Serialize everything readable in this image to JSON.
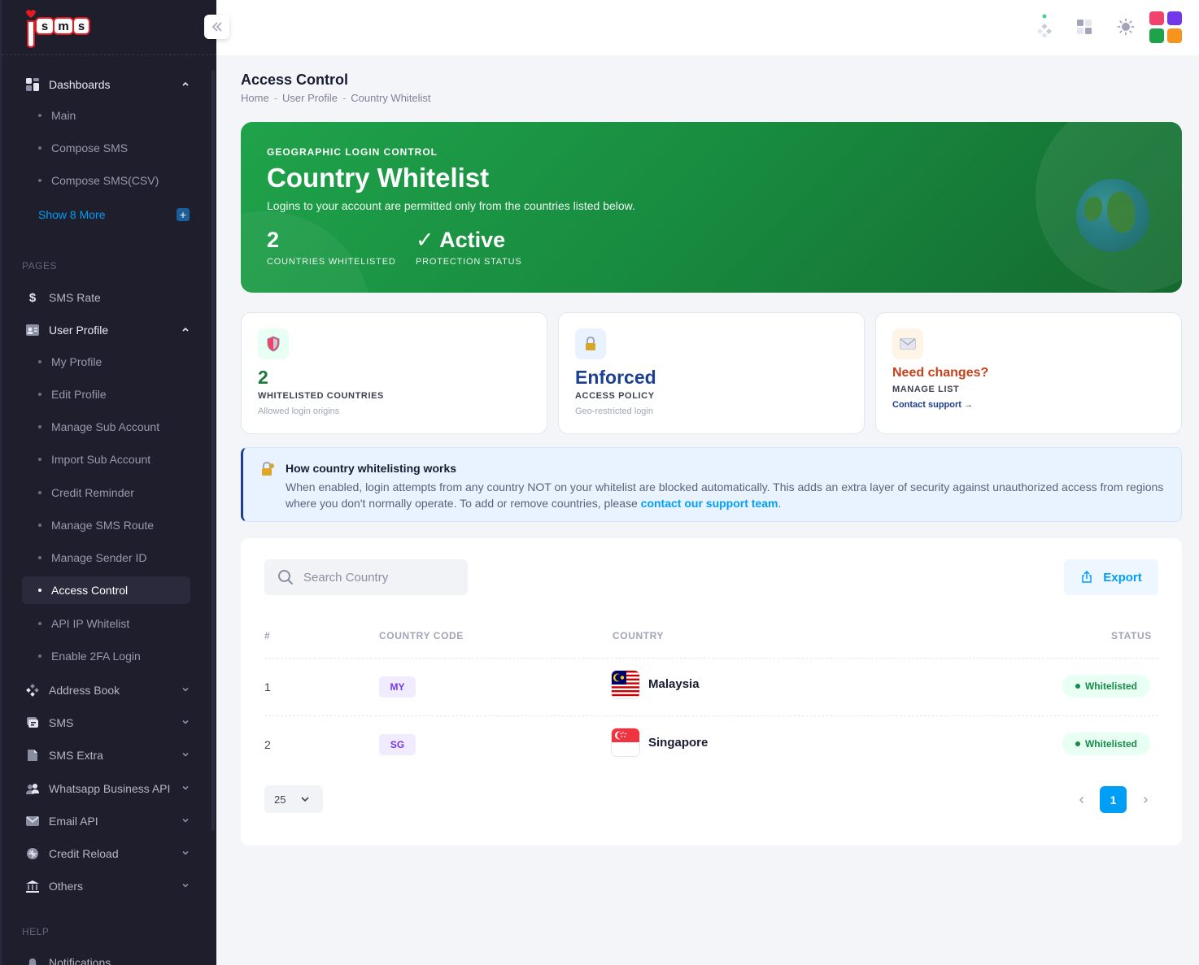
{
  "sidebar": {
    "logo_text": "sms",
    "menu": {
      "dashboards": "Dashboards",
      "dash_items": [
        "Main",
        "Compose SMS",
        "Compose SMS(CSV)"
      ],
      "show_more": "Show 8 More"
    },
    "pages_label": "PAGES",
    "sms_rate": "SMS Rate",
    "user_profile": "User Profile",
    "profile_items": [
      "My Profile",
      "Edit Profile",
      "Manage Sub Account",
      "Import Sub Account",
      "Credit Reminder",
      "Manage SMS Route",
      "Manage Sender ID",
      "Access Control",
      "API IP Whitelist",
      "Enable 2FA Login"
    ],
    "groups": [
      "Address Book",
      "SMS",
      "SMS Extra",
      "Whatsapp Business API",
      "Email API",
      "Credit Reload",
      "Others"
    ],
    "help_label": "HELP",
    "help_item": "Notifications"
  },
  "header": {
    "icons": [
      "menu-dots-icon",
      "layout-icon",
      "theme-sun-icon",
      "app-grid-icon"
    ]
  },
  "page": {
    "title": "Access Control",
    "breadcrumb": [
      "Home",
      "User Profile",
      "Country Whitelist"
    ],
    "breadcrumb_sep": "-"
  },
  "hero": {
    "eyebrow": "GEOGRAPHIC LOGIN CONTROL",
    "title": "Country Whitelist",
    "description": "Logins to your account are permitted only from the countries listed below.",
    "stat1_value": "2",
    "stat1_label": "COUNTRIES WHITELISTED",
    "stat2_value": "✓ Active",
    "stat2_label": "PROTECTION STATUS"
  },
  "cards": [
    {
      "value": "2",
      "label": "WHITELISTED COUNTRIES",
      "sub": "Allowed login origins",
      "icon": "shield-icon",
      "color": "#1b7a3a"
    },
    {
      "value": "Enforced",
      "label": "ACCESS POLICY",
      "sub": "Geo-restricted login",
      "icon": "lock-icon",
      "color": "#1b3f91"
    },
    {
      "value": "Need changes?",
      "label": "MANAGE LIST",
      "link": "Contact support →",
      "icon": "envelope-icon",
      "color": "#c4421a"
    }
  ],
  "info": {
    "title": "How country whitelisting works",
    "body": "When enabled, login attempts from any country NOT on your whitelist are blocked automatically. This adds an extra layer of security against unauthorized access from regions where you don't normally operate. To add or remove countries, please ",
    "link": "contact our support team",
    "tail": "."
  },
  "table": {
    "search_placeholder": "Search Country",
    "export_label": "Export",
    "columns": [
      "#",
      "COUNTRY CODE",
      "COUNTRY",
      "STATUS"
    ],
    "rows": [
      {
        "num": "1",
        "code": "MY",
        "country": "Malaysia",
        "status": "Whitelisted"
      },
      {
        "num": "2",
        "code": "SG",
        "country": "Singapore",
        "status": "Whitelisted"
      }
    ],
    "page_size": "25",
    "current_page": "1"
  },
  "colors": {
    "sidebar_bg": "#1e1e2d",
    "hero_green": "#1fa34a",
    "accent_blue": "#009ef7",
    "status_green": "#178c48"
  }
}
